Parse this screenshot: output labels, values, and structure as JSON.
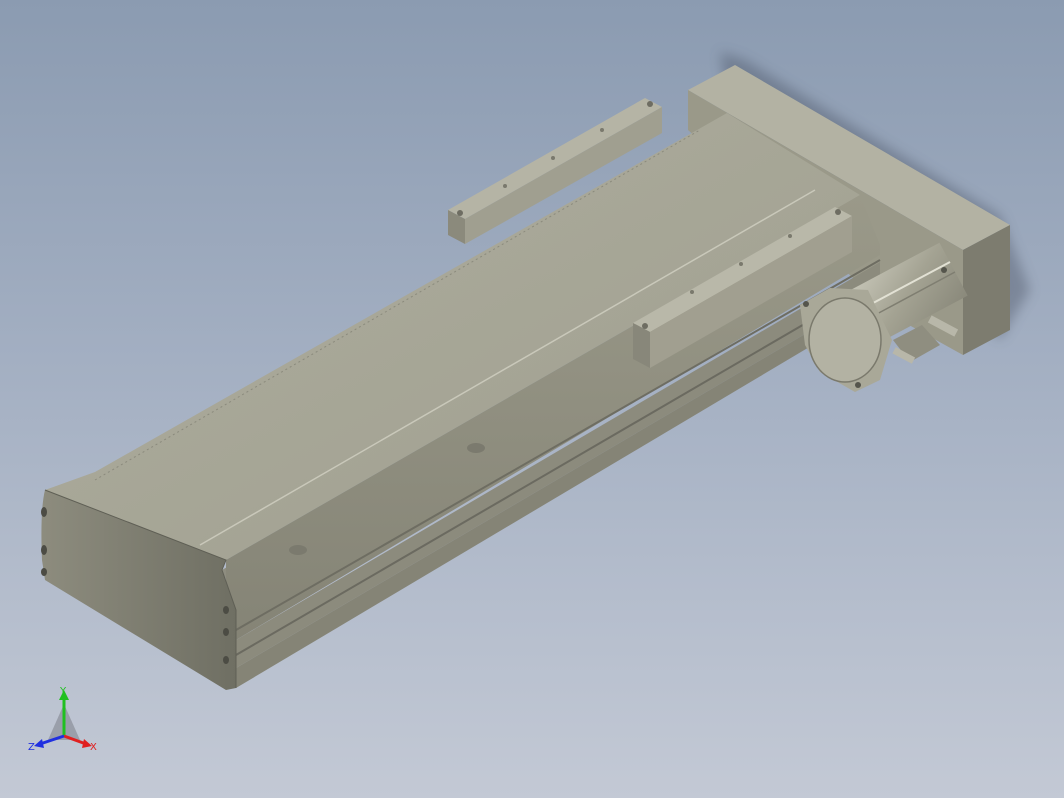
{
  "viewport": {
    "background_top": "#8b9bb1",
    "background_bottom": "#c3c9d5"
  },
  "model": {
    "name": "linear-actuator-module",
    "body_color": "#9e9d8d",
    "top_color": "#a7a696",
    "side_color": "#8f8e7f",
    "end_color": "#77776a",
    "motor_color": "#9c9b8b"
  },
  "triad": {
    "x_label": "X",
    "y_label": "Y",
    "z_label": "Z",
    "x_color": "#e02020",
    "y_color": "#20c020",
    "z_color": "#2030e0"
  }
}
